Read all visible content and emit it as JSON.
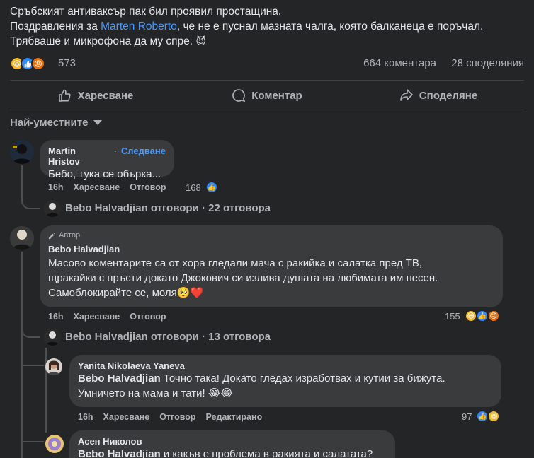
{
  "post": {
    "line1": "Сръбският антиваксър пак бил проявил простащина.",
    "line2_prefix": "Поздравления за ",
    "line2_mention": "Marten Roberto",
    "line2_suffix": ", че не е пуснал мазната чалга, която балканеца е поръчал.",
    "line3": "Трябваше и микрофона да му спре.",
    "reaction_count": "573",
    "comments_count": "664 коментара",
    "shares_count": "28 споделяния"
  },
  "actions": {
    "like": "Харесване",
    "comment": "Коментар",
    "share": "Споделяне"
  },
  "sort": {
    "label": "Най-уместните"
  },
  "comments": [
    {
      "name": "Martin Hristov",
      "follow": "Следване",
      "text": "Бебо, тука се обърка...",
      "time": "16h",
      "like": "Харесване",
      "reply": "Отговор",
      "reactions": "168",
      "replies_link": "Bebo Halvadjian отговори · 22 отговора"
    },
    {
      "badge": "Автор",
      "name": "Bebo Halvadjian",
      "text1": "Масово коментарите са от хора гледали мача с ракийка и салатка пред ТВ,",
      "text2": "щракайки с пръсти докато Джокович си излива душата на любимата им песен.",
      "text3": "Самоблокирайте се, моля",
      "time": "16h",
      "like": "Харесване",
      "reply": "Отговор",
      "reactions": "155",
      "replies_link": "Bebo Halvadjian отговори · 13 отговора"
    }
  ],
  "replies": [
    {
      "name": "Yanita Nikolaeva Yaneva",
      "tag": "Bebo Halvadjian",
      "text1": " Точно така! Докато гледах изработвах и кутии за бижута.",
      "text2": "Умничето на мама и тати!",
      "time": "16h",
      "like": "Харесване",
      "reply": "Отговор",
      "edited": "Редактирано",
      "reactions": "97"
    },
    {
      "name": "Асен Николов",
      "tag": "Bebo Halvadjian",
      "text1": " и какъв е проблема в ракията и салатата?"
    }
  ],
  "colors": {
    "accent": "#4599ff",
    "like": "#2d88ff",
    "haha": "#f7b928",
    "angry": "#e9710f",
    "bg": "#242526",
    "bubble": "#3a3b3c"
  }
}
